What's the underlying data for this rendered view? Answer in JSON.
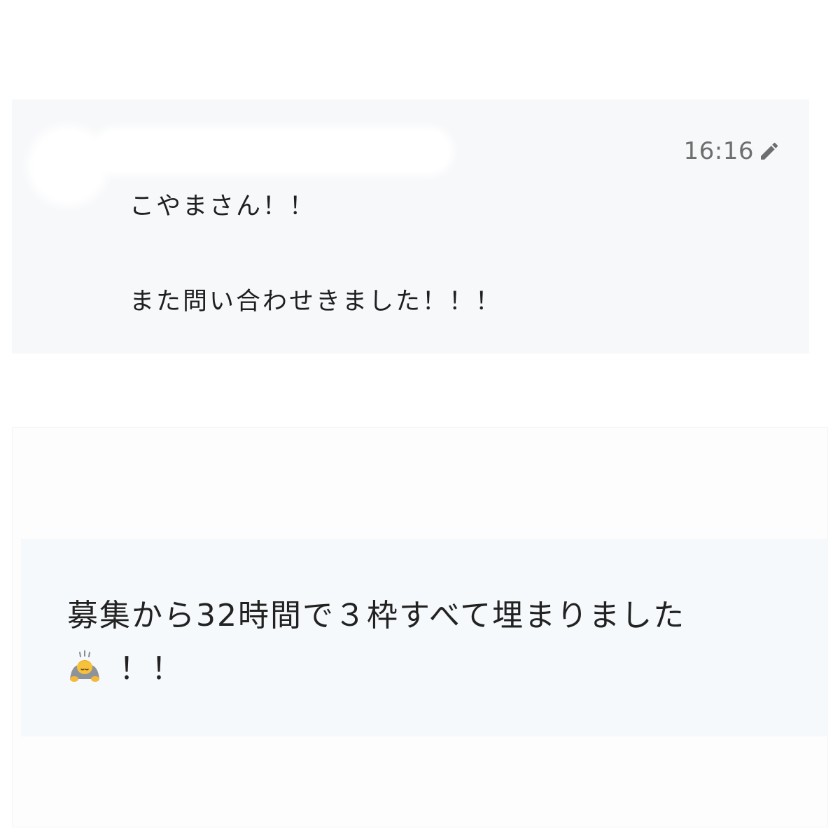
{
  "message": {
    "time": "16:16",
    "edit_icon": "pencil-icon",
    "lines": [
      "こやまさん！！",
      "また問い合わせきました！！！"
    ]
  },
  "result": {
    "line1": "募集から32時間で３枠すべて埋まりました",
    "emoji": "person-bowing-icon",
    "line2_suffix": "！！"
  }
}
